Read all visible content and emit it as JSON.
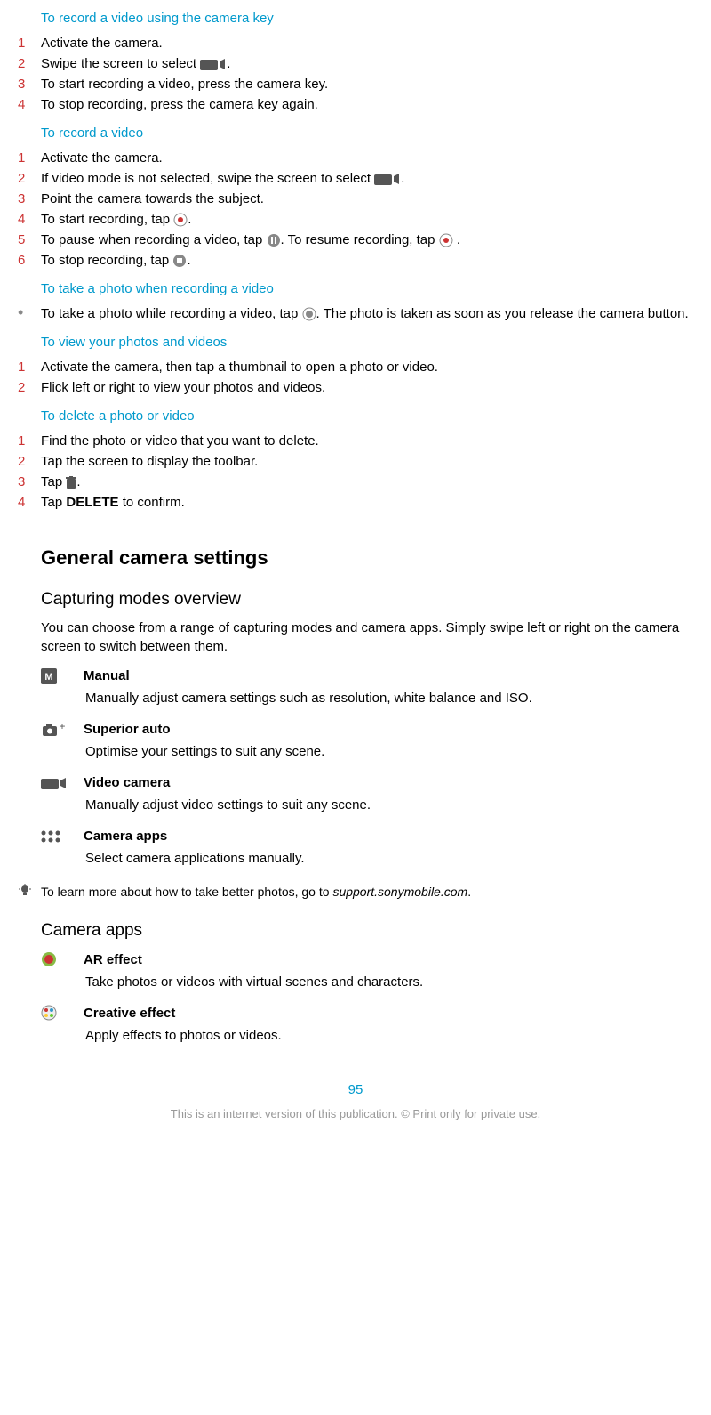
{
  "sec1": {
    "title": "To record a video using the camera key",
    "steps": [
      "Activate the camera.",
      "Swipe the screen to select",
      "To start recording a video, press the camera key.",
      "To stop recording, press the camera key again."
    ]
  },
  "sec2": {
    "title": "To record a video",
    "steps": {
      "s1": "Activate the camera.",
      "s2a": "If video mode is not selected, swipe the screen to select",
      "s2b": ".",
      "s3": "Point the camera towards the subject.",
      "s4a": "To start recording, tap",
      "s4b": ".",
      "s5a": "To pause when recording a video, tap",
      "s5b": ". To resume recording, tap",
      "s5c": " .",
      "s6a": "To stop recording, tap",
      "s6b": "."
    }
  },
  "sec3": {
    "title": "To take a photo when recording a video",
    "text_a": "To take a photo while recording a video, tap",
    "text_b": ". The photo is taken as soon as you release the camera button."
  },
  "sec4": {
    "title": "To view your photos and videos",
    "steps": [
      "Activate the camera, then tap a thumbnail to open a photo or video.",
      "Flick left or right to view your photos and videos."
    ]
  },
  "sec5": {
    "title": "To delete a photo or video",
    "steps": {
      "s1": "Find the photo or video that you want to delete.",
      "s2": "Tap the screen to display the toolbar.",
      "s3a": "Tap",
      "s3b": ".",
      "s4a": "Tap ",
      "s4b": "DELETE",
      "s4c": " to confirm."
    }
  },
  "h2": "General camera settings",
  "h3a": "Capturing modes overview",
  "intro": "You can choose from a range of capturing modes and camera apps. Simply swipe left or right on the camera screen to switch between them.",
  "modes": [
    {
      "title": "Manual",
      "desc": "Manually adjust camera settings such as resolution, white balance and ISO."
    },
    {
      "title": "Superior auto",
      "desc": "Optimise your settings to suit any scene."
    },
    {
      "title": "Video camera",
      "desc": "Manually adjust video settings to suit any scene."
    },
    {
      "title": "Camera apps",
      "desc": "Select camera applications manually."
    }
  ],
  "tip_a": "To learn more about how to take better photos, go to ",
  "tip_b": "support.sonymobile.com",
  "tip_c": ".",
  "h3b": "Camera apps",
  "apps": [
    {
      "title": "AR effect",
      "desc": "Take photos or videos with virtual scenes and characters."
    },
    {
      "title": "Creative effect",
      "desc": "Apply effects to photos or videos."
    }
  ],
  "page": "95",
  "footer": "This is an internet version of this publication. © Print only for private use."
}
